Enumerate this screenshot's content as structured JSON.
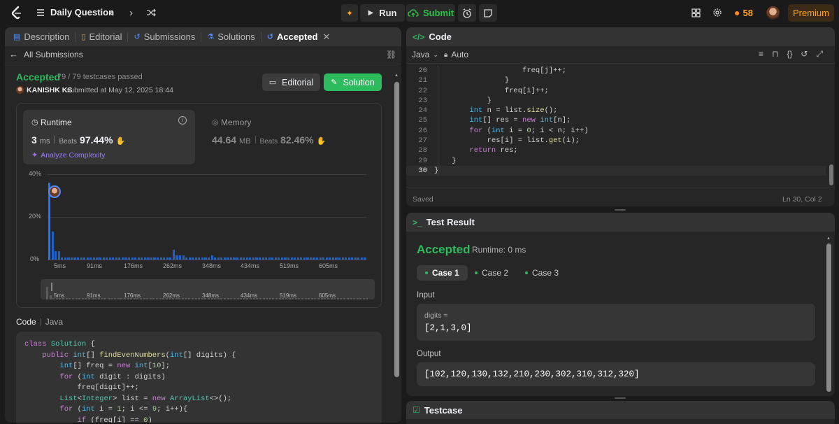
{
  "topbar": {
    "title": "Daily Question",
    "run_label": "Run",
    "submit_label": "Submit",
    "streak": "58",
    "premium_label": "Premium",
    "colors": {
      "submit": "#28c244",
      "streak": "#ffa116",
      "premium": "#ffa116"
    }
  },
  "left_tabs": {
    "description": "Description",
    "editorial": "Editorial",
    "submissions": "Submissions",
    "solutions": "Solutions",
    "accepted": "Accepted"
  },
  "submission": {
    "back_label": "All Submissions",
    "status": "Accepted",
    "testcases": "79 / 79 testcases passed",
    "user": "KANISHK KS",
    "submitted_at": "submitted at May 12, 2025 18:44",
    "editorial_button": "Editorial",
    "solution_button": "Solution",
    "runtime_label": "Runtime",
    "runtime_value": "3",
    "runtime_unit": "ms",
    "beats_label": "Beats",
    "runtime_beats": "97.44%",
    "analyze_label": "Analyze Complexity",
    "memory_label": "Memory",
    "memory_value": "44.64",
    "memory_unit": "MB",
    "memory_beats": "82.46%"
  },
  "chart_data": {
    "type": "bar",
    "ytick_labels": [
      "40%",
      "20%",
      "0%"
    ],
    "ylim": [
      0,
      40
    ],
    "xtick_labels": [
      "5ms",
      "91ms",
      "176ms",
      "262ms",
      "348ms",
      "434ms",
      "519ms",
      "605ms"
    ],
    "values": [
      36,
      13,
      4,
      4,
      1,
      1,
      1,
      1,
      1,
      1,
      1,
      1,
      1,
      1,
      1,
      1,
      1,
      1,
      1,
      1,
      1,
      1,
      1,
      1,
      1,
      1,
      1,
      1,
      1,
      1,
      1,
      1,
      1,
      1,
      1,
      1,
      1,
      1,
      1,
      4.5,
      2,
      2,
      2,
      1,
      1,
      1,
      1,
      1,
      1,
      1,
      1,
      2,
      1,
      1,
      1,
      1,
      1,
      1,
      1,
      1,
      1,
      1,
      1,
      1,
      1,
      1,
      1,
      1,
      1,
      1,
      1,
      1,
      1,
      1,
      1,
      1,
      1,
      1,
      1,
      1,
      1,
      1,
      1,
      1,
      1,
      1,
      1,
      1,
      1,
      1,
      1,
      1,
      1,
      1,
      1,
      1,
      1,
      1,
      1,
      1
    ],
    "highlight_index": 0,
    "grid": true
  },
  "left_code": {
    "header": "Code",
    "language": "Java",
    "lines": [
      [
        [
          "kw",
          "class "
        ],
        [
          "cls",
          "Solution "
        ],
        [
          "pl",
          "{"
        ]
      ],
      [
        [
          "pl",
          "    "
        ],
        [
          "kw",
          "public "
        ],
        [
          "ty",
          "int"
        ],
        [
          "pl",
          "[] "
        ],
        [
          "fn",
          "findEvenNumbers"
        ],
        [
          "pl",
          "("
        ],
        [
          "ty",
          "int"
        ],
        [
          "pl",
          "[] digits) {"
        ]
      ],
      [
        [
          "pl",
          "        "
        ],
        [
          "ty",
          "int"
        ],
        [
          "pl",
          "[] freq = "
        ],
        [
          "kw",
          "new "
        ],
        [
          "ty",
          "int"
        ],
        [
          "pl",
          "["
        ],
        [
          "num",
          "10"
        ],
        [
          "pl",
          "];"
        ]
      ],
      [
        [
          "pl",
          "        "
        ],
        [
          "kw",
          "for "
        ],
        [
          "pl",
          "("
        ],
        [
          "ty",
          "int "
        ],
        [
          "pl",
          "digit : digits)"
        ]
      ],
      [
        [
          "pl",
          "            freq[digit]++;"
        ]
      ],
      [
        [
          "pl",
          "        "
        ],
        [
          "cls",
          "List"
        ],
        [
          "pl",
          "<"
        ],
        [
          "cls",
          "Integer"
        ],
        [
          "pl",
          "> list = "
        ],
        [
          "kw",
          "new "
        ],
        [
          "cls",
          "ArrayList"
        ],
        [
          "pl",
          "<>();"
        ]
      ],
      [
        [
          "pl",
          "        "
        ],
        [
          "kw",
          "for "
        ],
        [
          "pl",
          "("
        ],
        [
          "ty",
          "int "
        ],
        [
          "pl",
          "i = "
        ],
        [
          "num",
          "1"
        ],
        [
          "pl",
          "; i <= "
        ],
        [
          "num",
          "9"
        ],
        [
          "pl",
          "; i++){"
        ]
      ],
      [
        [
          "pl",
          "            "
        ],
        [
          "kw",
          "if "
        ],
        [
          "pl",
          "(freq[i] == "
        ],
        [
          "num",
          "0"
        ],
        [
          "pl",
          ")"
        ]
      ]
    ]
  },
  "right_code": {
    "header": "Code",
    "language": "Java",
    "auto_label": "Auto",
    "status": "Saved",
    "position": "Ln 30, Col 2",
    "line_numbers": [
      "20",
      "21",
      "22",
      "23",
      "24",
      "25",
      "26",
      "27",
      "28",
      "29",
      "30"
    ],
    "lines": [
      [
        [
          "pl",
          "                    freq[j]++;"
        ]
      ],
      [
        [
          "pl",
          "                }"
        ]
      ],
      [
        [
          "pl",
          "                freq[i]++;"
        ]
      ],
      [
        [
          "pl",
          "            }"
        ]
      ],
      [
        [
          "pl",
          "        "
        ],
        [
          "ty",
          "int "
        ],
        [
          "pl",
          "n = list."
        ],
        [
          "fn",
          "size"
        ],
        [
          "pl",
          "();"
        ]
      ],
      [
        [
          "pl",
          "        "
        ],
        [
          "ty",
          "int"
        ],
        [
          "pl",
          "[] res = "
        ],
        [
          "kw",
          "new "
        ],
        [
          "ty",
          "int"
        ],
        [
          "pl",
          "[n];"
        ]
      ],
      [
        [
          "pl",
          "        "
        ],
        [
          "kw",
          "for "
        ],
        [
          "pl",
          "("
        ],
        [
          "ty",
          "int "
        ],
        [
          "pl",
          "i = "
        ],
        [
          "num",
          "0"
        ],
        [
          "pl",
          "; i < n; i++)"
        ]
      ],
      [
        [
          "pl",
          "            res[i] = list."
        ],
        [
          "fn",
          "get"
        ],
        [
          "pl",
          "(i);"
        ]
      ],
      [
        [
          "pl",
          "        "
        ],
        [
          "kw",
          "return "
        ],
        [
          "pl",
          "res;"
        ]
      ],
      [
        [
          "pl",
          "    }"
        ]
      ],
      [
        [
          "pl",
          "}"
        ]
      ]
    ]
  },
  "test_result": {
    "header": "Test Result",
    "status": "Accepted",
    "runtime": "Runtime: 0 ms",
    "cases": [
      "Case 1",
      "Case 2",
      "Case 3"
    ],
    "input_label": "Input",
    "input_var": "digits =",
    "input_value": "[2,1,3,0]",
    "output_label": "Output",
    "output_value": "[102,120,130,132,210,230,302,310,312,320]"
  },
  "testcase": {
    "header": "Testcase"
  }
}
